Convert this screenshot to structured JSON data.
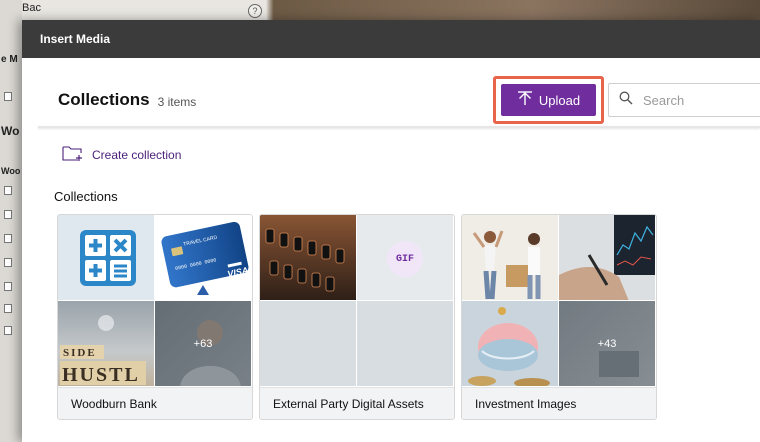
{
  "background": {
    "top_text": "Bac",
    "left_fragments": [
      "e M",
      "Wo",
      "Woo"
    ]
  },
  "modal": {
    "title": "Insert Media"
  },
  "header": {
    "title": "Collections",
    "count": "3 items"
  },
  "toolbar": {
    "upload_label": "Upload",
    "search_placeholder": "Search"
  },
  "create_collection_label": "Create collection",
  "section_label": "Collections",
  "collections": [
    {
      "name": "Woodburn Bank",
      "more_count": "+63"
    },
    {
      "name": "External Party Digital Assets",
      "gif_label": "GIF"
    },
    {
      "name": "Investment Images",
      "more_count": "+43"
    }
  ],
  "thumb_texts": {
    "travel_card": "TRAVEL CARD",
    "card_number": "0000 0000 0000",
    "visa": "VISA",
    "side_row": "SIDE",
    "hustle_row": "HUSTL"
  },
  "colors": {
    "accent": "#6f2d9e",
    "highlight_border": "#e8644a",
    "titlebar": "#3b3b3b"
  }
}
